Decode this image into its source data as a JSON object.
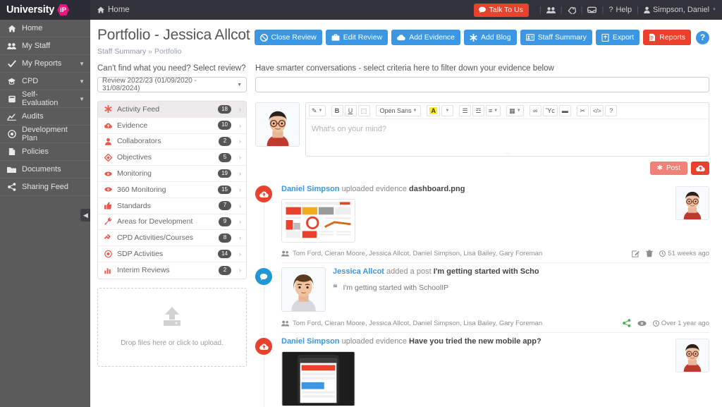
{
  "topbar": {
    "brand_name": "University",
    "brand_badge": "iP",
    "home_label": "Home",
    "talk_label": "Talk To Us",
    "help_label": "Help",
    "user_label": "Simpson, Daniel",
    "accent_red": "#e8412c",
    "brand_pink": "#e8167e"
  },
  "sidebar": {
    "items": [
      {
        "label": "Home",
        "icon": "home-icon",
        "caret": false
      },
      {
        "label": "My Staff",
        "icon": "users-icon",
        "caret": false
      },
      {
        "label": "My Reports",
        "icon": "check-icon",
        "caret": true
      },
      {
        "label": "CPD",
        "icon": "graduation-icon",
        "caret": true
      },
      {
        "label": "Self-Evaluation",
        "icon": "book-icon",
        "caret": true
      },
      {
        "label": "Audits",
        "icon": "chart-icon",
        "caret": false
      },
      {
        "label": "Development Plan",
        "icon": "target-icon",
        "caret": false
      },
      {
        "label": "Policies",
        "icon": "file-icon",
        "caret": false
      },
      {
        "label": "Documents",
        "icon": "folder-icon",
        "caret": false
      },
      {
        "label": "Sharing Feed",
        "icon": "share-icon",
        "caret": false
      }
    ]
  },
  "page": {
    "title": "Portfolio - Jessica Allcot",
    "breadcrumb_root": "Staff Summary",
    "breadcrumb_sep": "»",
    "breadcrumb_current": "Portfolio"
  },
  "actions": [
    {
      "label": "Close Review",
      "icon": "ban-icon",
      "color": "blue"
    },
    {
      "label": "Edit Review",
      "icon": "briefcase-icon",
      "color": "blue"
    },
    {
      "label": "Add Evidence",
      "icon": "cloud-upload-icon",
      "color": "blue"
    },
    {
      "label": "Add Blog",
      "icon": "asterisk-icon",
      "color": "blue"
    },
    {
      "label": "Staff Summary",
      "icon": "id-card-icon",
      "color": "blue"
    },
    {
      "label": "Export",
      "icon": "export-icon",
      "color": "blue"
    },
    {
      "label": "Reports",
      "icon": "report-icon",
      "color": "red"
    }
  ],
  "help_button": "?",
  "left": {
    "select_heading": "Can't find what you need? Select review?",
    "selected_review": "Review 2022/23 (01/09/2020 - 31/08/2024)",
    "nav": [
      {
        "label": "Activity Feed",
        "badge": "18",
        "icon": "asterisk-icon",
        "active": true
      },
      {
        "label": "Evidence",
        "badge": "10",
        "icon": "cloud-upload-icon",
        "active": false
      },
      {
        "label": "Collaborators",
        "badge": "2",
        "icon": "user-icon",
        "active": false
      },
      {
        "label": "Objectives",
        "badge": "5",
        "icon": "diamond-icon",
        "active": false
      },
      {
        "label": "Monitoring",
        "badge": "19",
        "icon": "eye-icon",
        "active": false
      },
      {
        "label": "360 Monitoring",
        "badge": "15",
        "icon": "eye-icon",
        "active": false
      },
      {
        "label": "Standards",
        "badge": "7",
        "icon": "thumbs-up-icon",
        "active": false
      },
      {
        "label": "Areas for Development",
        "badge": "9",
        "icon": "wrench-icon",
        "active": false
      },
      {
        "label": "CPD Activities/Courses",
        "badge": "8",
        "icon": "puzzle-icon",
        "active": false
      },
      {
        "label": "SDP Activities",
        "badge": "14",
        "icon": "target-icon",
        "active": false
      },
      {
        "label": "Interim Reviews",
        "badge": "2",
        "icon": "bar-chart-icon",
        "active": false
      }
    ],
    "dropzone_text": "Drop files here or click to upload."
  },
  "right": {
    "filter_label": "Have smarter conversations - select criteria here to filter down your evidence below",
    "filter_value": "",
    "filter_placeholder": "",
    "editor": {
      "placeholder": "What's on your mind?",
      "font_name": "Open Sans",
      "toolbar": [
        {
          "name": "style-dropdown",
          "glyph": "✎",
          "caret": true
        },
        {
          "name": "bold-button",
          "glyph": "B",
          "caret": false
        },
        {
          "name": "underline-button",
          "glyph": "U",
          "caret": false
        },
        {
          "name": "clear-format-button",
          "glyph": "⬚",
          "caret": false
        },
        {
          "name": "font-dropdown",
          "glyph": "Open Sans",
          "caret": true
        },
        {
          "name": "highlight-color-button",
          "glyph": "A",
          "caret": false
        },
        {
          "name": "text-color-dropdown",
          "glyph": "",
          "caret": true
        },
        {
          "name": "unordered-list-button",
          "glyph": "☰",
          "caret": false
        },
        {
          "name": "ordered-list-button",
          "glyph": "☲",
          "caret": false
        },
        {
          "name": "align-dropdown",
          "glyph": "≡",
          "caret": true
        },
        {
          "name": "table-dropdown",
          "glyph": "▦",
          "caret": true
        },
        {
          "name": "link-button",
          "glyph": "∞",
          "caret": false
        },
        {
          "name": "image-button",
          "glyph": "Ὓc",
          "caret": false
        },
        {
          "name": "video-button",
          "glyph": "▬",
          "caret": false
        },
        {
          "name": "unlink-button",
          "glyph": "✂",
          "caret": false
        },
        {
          "name": "code-view-button",
          "glyph": "</>",
          "caret": false
        },
        {
          "name": "editor-help-button",
          "glyph": "?",
          "caret": false
        }
      ]
    },
    "post_label": "Post",
    "upload_label": ""
  },
  "feed": [
    {
      "type": "evidence",
      "author": "Daniel Simpson",
      "action": "uploaded evidence",
      "subject": "dashboard.png",
      "has_thumb": true,
      "thumb_kind": "dashboard-screenshot",
      "shared_with": "Tom Ford, Cieran Moore, Jessica Allcot, Daniel Simpson, Lisa Bailey, Gary Foreman",
      "timestamp": "51 weeks ago",
      "actions": [
        "edit-icon",
        "delete-icon"
      ],
      "right_avatar": true
    },
    {
      "type": "post",
      "author": "Jessica Allcot",
      "action": "added a post",
      "subject": "I'm getting started with Scho",
      "quote": "I'm getting started with SchoolIP",
      "has_thumb": false,
      "shared_with": "Tom Ford, Cieran Moore, Jessica Allcot, Daniel Simpson, Lisa Bailey, Gary Foreman",
      "timestamp": "Over 1 year ago",
      "actions": [
        "share-icon",
        "eye-icon"
      ],
      "right_avatar": false
    },
    {
      "type": "evidence",
      "author": "Daniel Simpson",
      "action": "uploaded evidence",
      "subject": "Have you tried the new mobile app?",
      "has_thumb": true,
      "thumb_kind": "mobile-screenshot",
      "shared_with": "",
      "timestamp": "",
      "actions": [],
      "right_avatar": true
    }
  ]
}
